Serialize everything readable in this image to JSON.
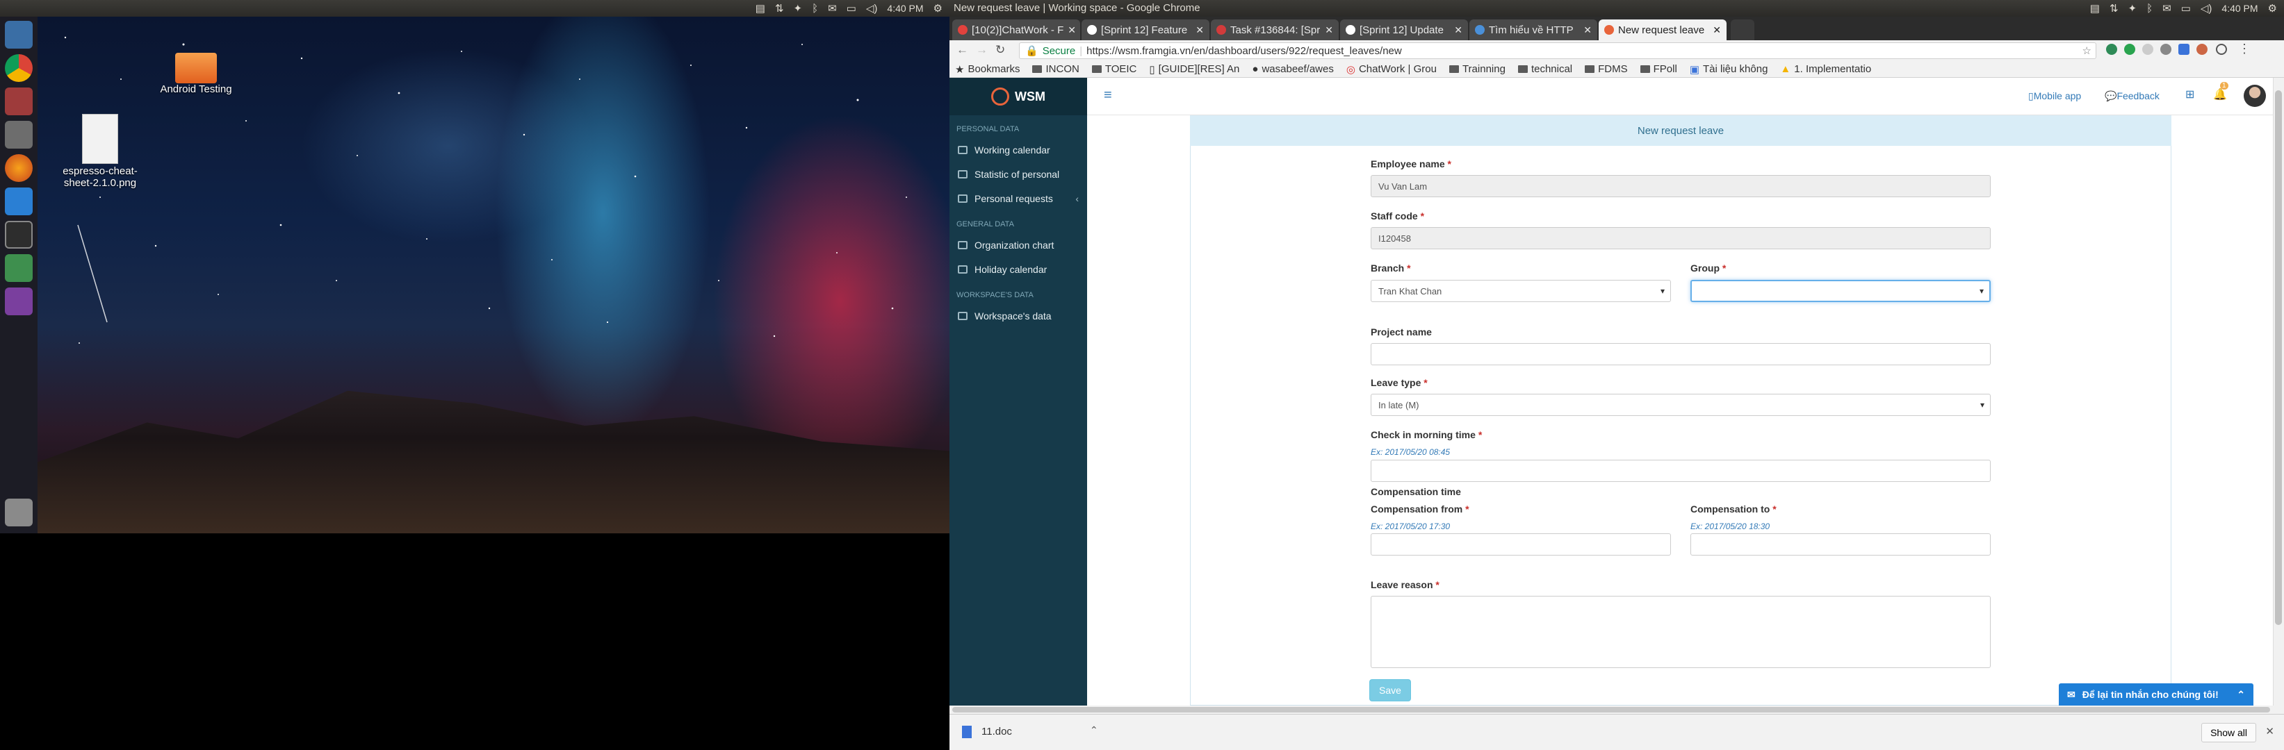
{
  "left_screen": {
    "topbar": {
      "clock": "4:40 PM"
    },
    "desktop_icons": [
      {
        "label": "Android Testing"
      },
      {
        "label": "espresso-cheat-sheet-2.1.0.png"
      }
    ]
  },
  "right_screen": {
    "topbar": {
      "window_title": "New request leave | Working space - Google Chrome",
      "clock": "4:40 PM"
    }
  },
  "browser": {
    "tabs": [
      {
        "label": "[10(2)]ChatWork - F",
        "active": false
      },
      {
        "label": "[Sprint 12] Feature",
        "active": false
      },
      {
        "label": "Task #136844: [Spr",
        "active": false
      },
      {
        "label": "[Sprint 12] Update",
        "active": false
      },
      {
        "label": "Tìm hiểu về HTTP",
        "active": false
      },
      {
        "label": "New request leave",
        "active": true
      }
    ],
    "secure_label": "Secure",
    "url": "https://wsm.framgia.vn/en/dashboard/users/922/request_leaves/new",
    "bookmarks": [
      "Bookmarks",
      "INCON",
      "TOEIC",
      "[GUIDE][RES] An",
      "wasabeef/awes",
      "ChatWork | Grou",
      "Trainning",
      "technical",
      "FDMS",
      "FPoll",
      "Tài liệu không",
      "1. Implementatio"
    ]
  },
  "app": {
    "brand": "WSM",
    "header": {
      "mobile_app": "Mobile app",
      "feedback": "Feedback",
      "notif_count": "1"
    },
    "sidebar": {
      "sections": [
        {
          "title": "PERSONAL DATA",
          "items": [
            "Working calendar",
            "Statistic of personal",
            "Personal requests"
          ]
        },
        {
          "title": "GENERAL DATA",
          "items": [
            "Organization chart",
            "Holiday calendar"
          ]
        },
        {
          "title": "WORKSPACE'S DATA",
          "items": [
            "Workspace's data"
          ]
        }
      ]
    },
    "form": {
      "title": "New request leave",
      "employee_name": {
        "label": "Employee name",
        "value": "Vu Van Lam"
      },
      "staff_code": {
        "label": "Staff code",
        "value": "I120458"
      },
      "branch": {
        "label": "Branch",
        "value": "Tran Khat Chan"
      },
      "group": {
        "label": "Group",
        "value": ""
      },
      "project_name": {
        "label": "Project name",
        "value": ""
      },
      "leave_type": {
        "label": "Leave type",
        "value": "In late (M)"
      },
      "check_in": {
        "label": "Check in morning time",
        "hint": "Ex: 2017/05/20 08:45"
      },
      "compensation_title": "Compensation time",
      "comp_from": {
        "label": "Compensation from",
        "hint": "Ex: 2017/05/20 17:30"
      },
      "comp_to": {
        "label": "Compensation to",
        "hint": "Ex: 2017/05/20 18:30"
      },
      "leave_reason": {
        "label": "Leave reason"
      },
      "required_mark": "*",
      "save": "Save"
    },
    "chat_widget": "Để lại tin nhắn cho chúng tôi!"
  },
  "downloads": {
    "file": "11.doc",
    "show_all": "Show all"
  },
  "colors": {
    "sidebar": "#163a4a",
    "panel_head": "#d9edf7",
    "save": "#5bc0de",
    "chat": "#1e7fd8"
  }
}
